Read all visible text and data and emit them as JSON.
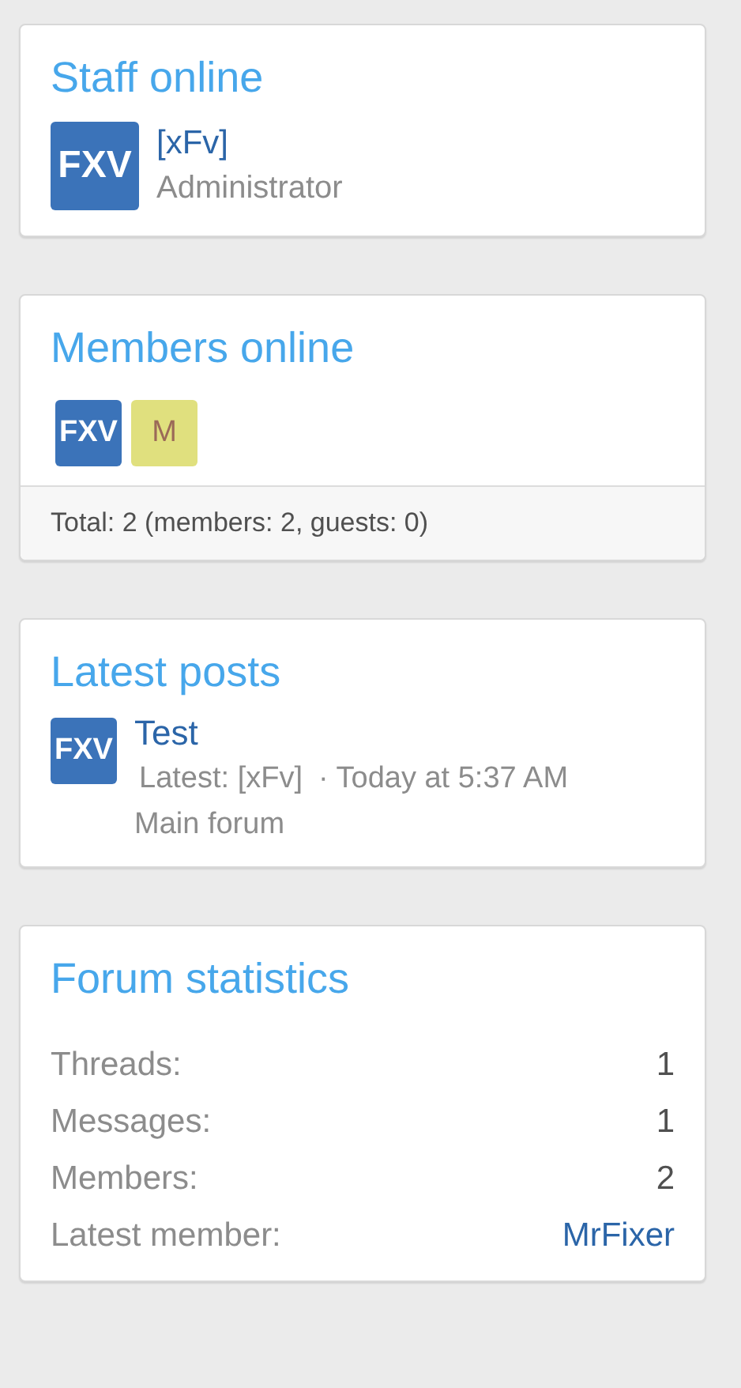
{
  "staff_online": {
    "title": "Staff online",
    "members": [
      {
        "avatar": "FXV",
        "name": "[xFv]",
        "role": "Administrator"
      }
    ]
  },
  "members_online": {
    "title": "Members online",
    "avatars": [
      {
        "letters": "FXV",
        "color": "#3b73b9"
      },
      {
        "letters": "M",
        "color": "#e0e07e"
      }
    ],
    "footer": "Total: 2 (members: 2, guests: 0)"
  },
  "latest_posts": {
    "title": "Latest posts",
    "posts": [
      {
        "avatar": "FXV",
        "title": "Test",
        "latest": "Latest: [xFv]",
        "time": "· Today at 5:37 AM",
        "forum": "Main forum"
      }
    ]
  },
  "forum_statistics": {
    "title": "Forum statistics",
    "rows": [
      {
        "label": "Threads:",
        "value": "1",
        "kind": "number"
      },
      {
        "label": "Messages:",
        "value": "1",
        "kind": "number"
      },
      {
        "label": "Members:",
        "value": "2",
        "kind": "number"
      },
      {
        "label": "Latest member:",
        "value": "MrFixer",
        "kind": "link"
      }
    ]
  }
}
